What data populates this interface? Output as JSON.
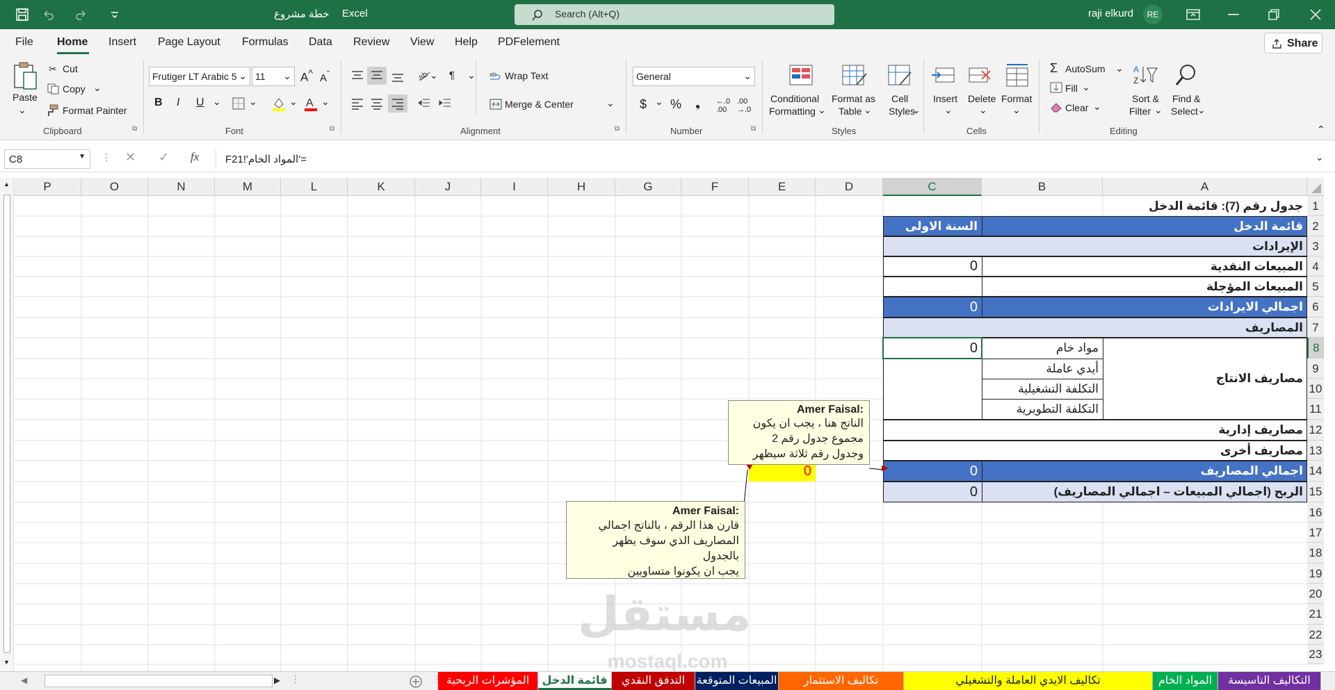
{
  "title": {
    "doc": "خطة مشروع",
    "app": "Excel",
    "user": "raji elkurd",
    "initials": "RE",
    "search": "Search (Alt+Q)"
  },
  "menu": [
    "File",
    "Home",
    "Insert",
    "Page Layout",
    "Formulas",
    "Data",
    "Review",
    "View",
    "Help",
    "PDFelement"
  ],
  "share": "Share",
  "ribbon": {
    "clipboard": {
      "paste": "Paste",
      "cut": "Cut",
      "copy": "Copy",
      "painter": "Format Painter",
      "label": "Clipboard"
    },
    "font": {
      "name": "Frutiger LT Arabic 5",
      "size": "11",
      "label": "Font"
    },
    "alignment": {
      "wrap": "Wrap Text",
      "merge": "Merge & Center",
      "label": "Alignment"
    },
    "number": {
      "format": "General",
      "label": "Number"
    },
    "styles": {
      "cond1": "Conditional",
      "cond2": "Formatting",
      "fmt1": "Format as",
      "fmt2": "Table",
      "cs1": "Cell",
      "cs2": "Styles",
      "label": "Styles"
    },
    "cells": {
      "insert": "Insert",
      "delete": "Delete",
      "format": "Format",
      "label": "Cells"
    },
    "editing": {
      "autosum": "AutoSum",
      "fill": "Fill",
      "clear": "Clear",
      "sort1": "Sort &",
      "sort2": "Filter",
      "find1": "Find &",
      "find2": "Select",
      "label": "Editing"
    }
  },
  "formula": {
    "name_box": "C8",
    "formula": "='المواد الخام'!F21",
    "fx": "fx"
  },
  "columns": [
    "P",
    "O",
    "N",
    "M",
    "L",
    "K",
    "J",
    "I",
    "H",
    "G",
    "F",
    "E",
    "D",
    "C",
    "B",
    "A"
  ],
  "rows": [
    "1",
    "2",
    "3",
    "4",
    "5",
    "6",
    "7",
    "8",
    "9",
    "10",
    "11",
    "12",
    "13",
    "14",
    "15",
    "16",
    "17",
    "18",
    "19",
    "20",
    "21",
    "22",
    "23"
  ],
  "cells": {
    "r1": "جدول رقم (7): قائمة الدخل",
    "r2a": "قائمة الدخل",
    "r2c": "السنة الاولى",
    "r3": "الإيرادات",
    "r4a": "المبيعات النقدية",
    "r4c": "0",
    "r5a": "المبيعات المؤجلة",
    "r6a": "اجمالي الايرادات",
    "r6c": "0",
    "r7": "المصاريف",
    "r8a": "مصاريف الانتاج",
    "r8b": "مواد خام",
    "r8c": "0",
    "r9b": "أيدي عاملة",
    "r10b": "التكلفة التشغيلية",
    "r11b": "التكلفة التطويرية",
    "r12a": "مصاريف إدارية",
    "r13a": "مصاريف أخرى",
    "r14a": "اجمالي المصاريف",
    "r14c": "0",
    "r14e": "0",
    "r15a": "الربح (اجمالي المبيعات – اجمالي المصاريف)",
    "r15c": "0"
  },
  "notes": [
    {
      "author": "Amer Faisal:",
      "lines": [
        "الناتج هنا ، يجب ان يكون",
        "مجموع جدول رقم 2",
        "وجدول رقم ثلاثة سيظهر"
      ]
    },
    {
      "author": "Amer Faisal:",
      "lines": [
        "قارن هذا الرقم ، بالناتج اجمالي",
        "المصاريف الذي سوف يظهر",
        "بالجدول",
        "يجب ان يكونوا متساويين"
      ]
    }
  ],
  "watermark": {
    "ar": "مستقل",
    "en": "mostaql.com"
  },
  "tabs": [
    {
      "label": "التكاليف التاسيسة",
      "color": "#7030a0"
    },
    {
      "label": "المواد الخام",
      "color": "#00b050"
    },
    {
      "label": "تكاليف الايدي العاملة والتشغيلي",
      "color": "#ffff00"
    },
    {
      "label": "تكاليف الاستثمار",
      "color": "#ff6600"
    },
    {
      "label": "المبيعات المتوقعة",
      "color": "#002060"
    },
    {
      "label": "التدفق النقدي",
      "color": "#c00000"
    },
    {
      "label": "قائمة الدخل",
      "color": "#ffffff"
    },
    {
      "label": "المؤشرات الربحية",
      "color": "#ff0000"
    }
  ]
}
